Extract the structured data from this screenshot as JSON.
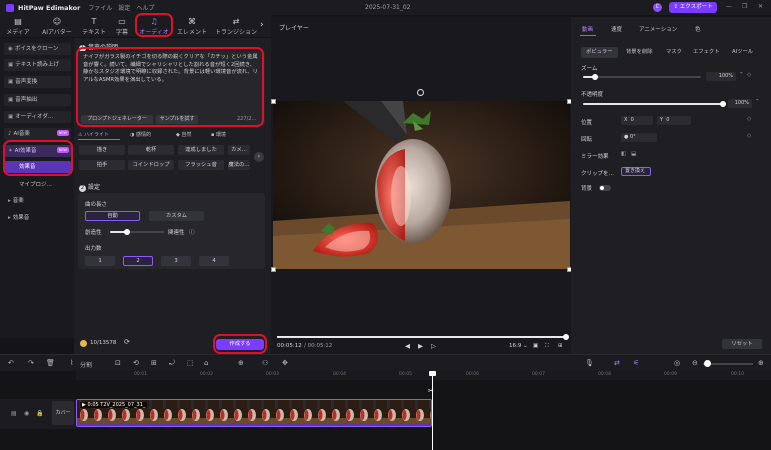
{
  "titlebar": {
    "app_name": "HitPaw Edimakor",
    "menus": [
      "ファイル",
      "設定",
      "ヘルプ"
    ],
    "date": "2025-07-31_02",
    "avatar_letter": "C",
    "export_label": "エクスポート",
    "win": [
      "—",
      "❐",
      "✕"
    ]
  },
  "toolbar": {
    "tabs": [
      {
        "label": "メディア",
        "icon": "▤"
      },
      {
        "label": "AIアバター",
        "icon": "☺"
      },
      {
        "label": "テキスト",
        "icon": "T"
      },
      {
        "label": "字幕",
        "icon": "▭"
      },
      {
        "label": "オーディオ",
        "icon": "♫"
      },
      {
        "label": "エレメント",
        "icon": "⌘"
      },
      {
        "label": "トランジション",
        "icon": "⇄"
      }
    ],
    "more": "›"
  },
  "sidebar": {
    "items": [
      {
        "label": "ボイスをクローン",
        "icon": "◉"
      },
      {
        "label": "テキスト読み上げ",
        "icon": "▣"
      },
      {
        "label": "音声変換",
        "icon": "▣"
      },
      {
        "label": "音声抽出",
        "icon": "▣"
      },
      {
        "label": "オーディオダ…",
        "icon": "▣"
      },
      {
        "label": "AI音楽",
        "icon": "♪",
        "badge": "NEW"
      },
      {
        "label": "AI効果音",
        "icon": "✦",
        "badge": "NEW"
      }
    ],
    "subitems": [
      "効果音",
      "マイプロジ…"
    ],
    "folders": [
      "音楽",
      "効果音"
    ]
  },
  "panel": {
    "step1_num": "1",
    "step1_title": "音声の説明",
    "prompt_text": "ナイフがガラス製のイチゴを切る際の鋭くクリアな「カチッ」という金属音が響く。続いて、繊細でシャリシャリとした割れる音が短く2回続き、静かなスタジオ環境で明瞭に収録された。背景には軽い環境音が流れ、リアルなASMR効果を演出している。",
    "prompt_generator": "プロンプトジェネレーター",
    "try_sample": "サンプルを試す",
    "char_count": "227/2…",
    "genres": [
      "ハイライト",
      "感情的",
      "自然",
      "環境"
    ],
    "chips_row1": [
      "描き",
      "乾杯",
      "達成しました",
      "カメ…"
    ],
    "chips_row2": [
      "拍手",
      "コインドロップ",
      "フラッシュ音",
      "魔法の…"
    ],
    "chip_next": "›",
    "step2_num": "2",
    "step2_title": "設定",
    "length_label": "曲の長さ",
    "length_options": [
      "自動",
      "カスタム"
    ],
    "creativity_label": "創造性",
    "relevance_label": "関連性",
    "info_icon": "ⓘ",
    "output_label": "出力数",
    "output_options": [
      "1",
      "2",
      "3",
      "4"
    ],
    "credits": "10/13578",
    "refresh_icon": "⟳",
    "generate_label": "作成する"
  },
  "player": {
    "title": "プレイヤー",
    "time_current": "00:05:12",
    "time_total": "/ 00:05:12",
    "ratio": "16:9",
    "rewind": "◀",
    "play": "▶",
    "forward": "▷",
    "ratio_caret": "⌄",
    "snapshot": "▣",
    "fullscreen": "⛶",
    "fit": "⊞"
  },
  "props": {
    "tabs": [
      "動画",
      "速度",
      "アニメーション",
      "色"
    ],
    "subtabs": [
      "ポピュラー",
      "背景を削除",
      "マスク",
      "エフェクト",
      "AIツール"
    ],
    "zoom_label": "ズーム",
    "zoom_value": "100%",
    "zoom_fraction": 0.1,
    "opacity_label": "不透明度",
    "opacity_value": "100%",
    "opacity_fraction": 1.0,
    "position_label": "位置",
    "pos_x_label": "X",
    "pos_x": "0",
    "pos_y_label": "Y",
    "pos_y": "0",
    "rotation_label": "回転",
    "rotation_value": "0°",
    "mirror_label": "ミラー効果",
    "clip_label": "クリップを…",
    "replace_label": "置き換え",
    "bg_label": "背景",
    "reset_label": "リセット",
    "keyframe": "◇",
    "stepper": "⌃"
  },
  "timeline": {
    "split_label": "分割",
    "ruler": [
      "00:01",
      "00:02",
      "00:03",
      "00:04",
      "00:05",
      "00:06",
      "00:07",
      "00:08",
      "00:09",
      "00:10"
    ],
    "cover_label": "カバー",
    "clip_label": "0:05 T2V_2025_07_31_",
    "clip_play_icon": "▶",
    "tools_left": [
      "↶",
      "↷",
      "🗑",
      "⌇"
    ],
    "tools_mid": [
      "⊡",
      "⟲",
      "⊞",
      "⤾",
      "⬚",
      "⌂",
      "⊕",
      "⚇",
      "✥"
    ],
    "tools_right": [
      "🎙",
      "⇄",
      "⚟",
      "◎",
      "⊖",
      "⊕"
    ],
    "track_icons": [
      "▤",
      "◉",
      "🔒"
    ]
  }
}
